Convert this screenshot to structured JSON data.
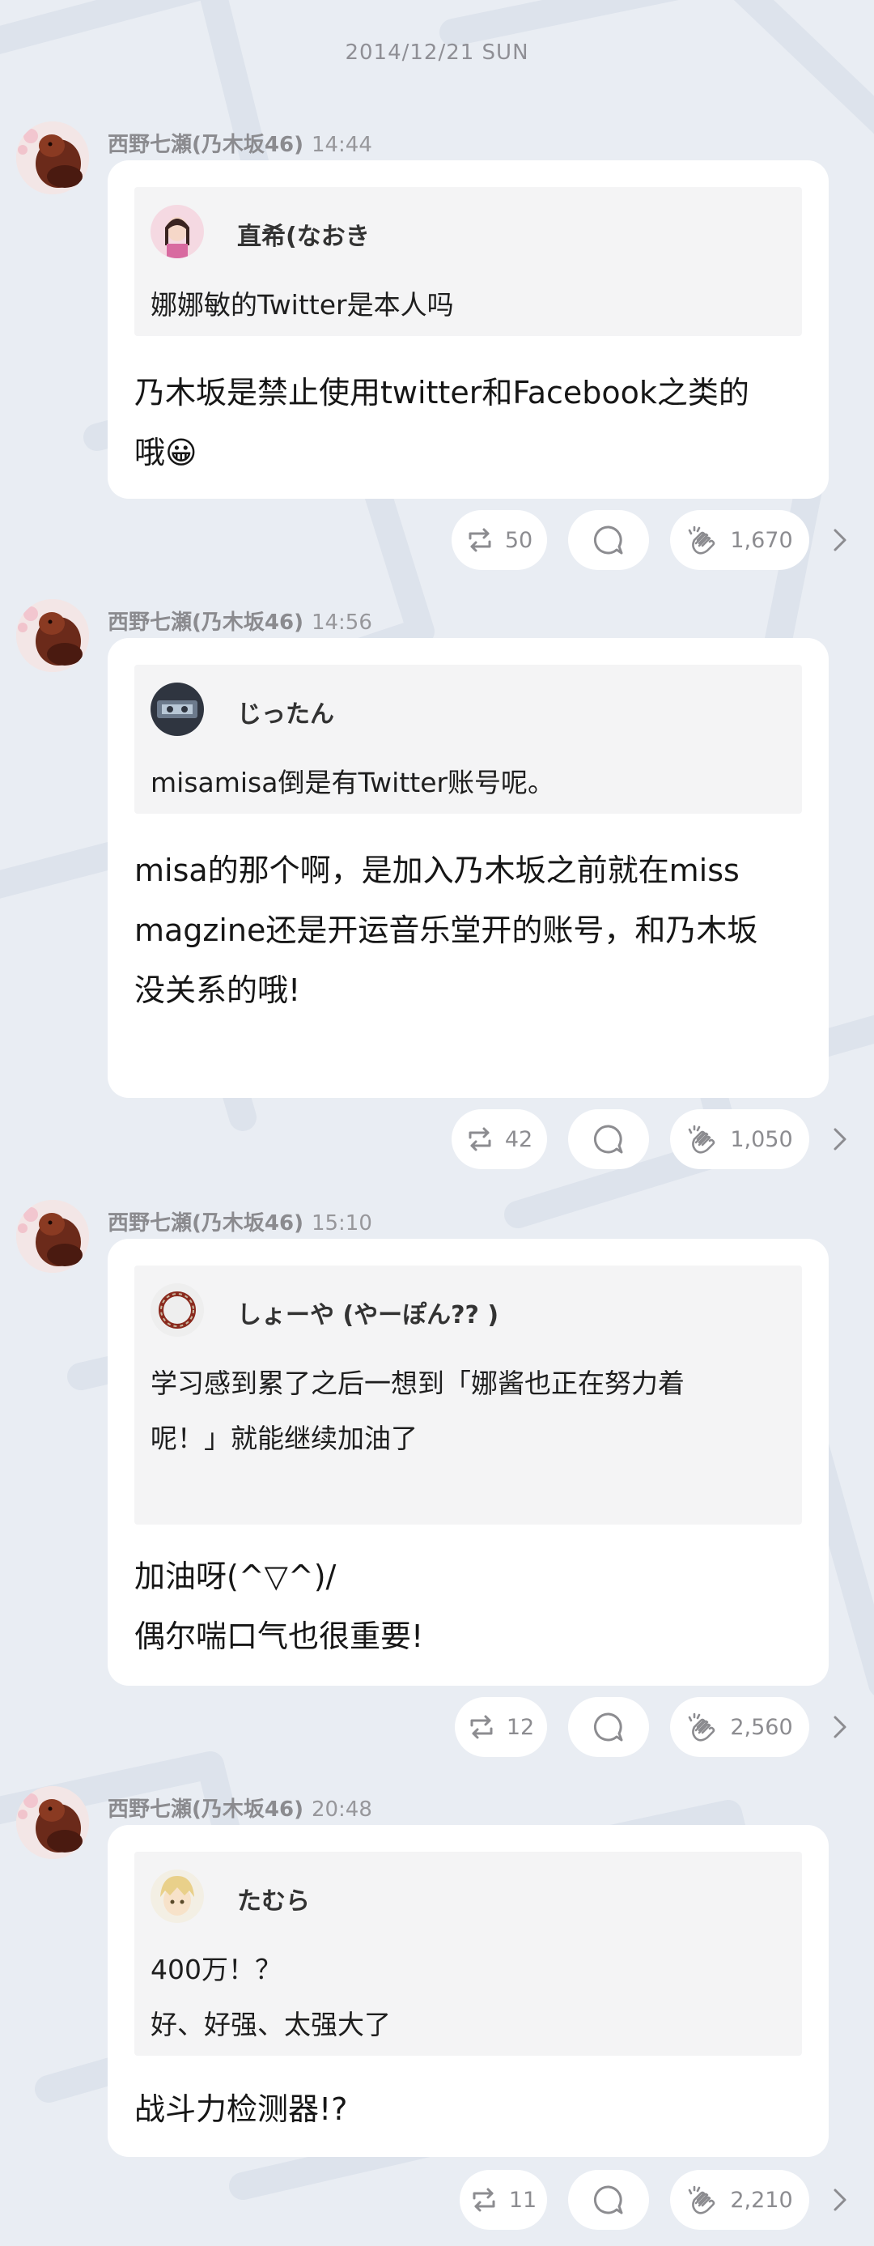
{
  "date_header": "2014/12/21 SUN",
  "messages": [
    {
      "author": "西野七瀬(乃木坂46)",
      "time": "14:44",
      "quote_name": "直希(なおき",
      "quote_text": "娜娜敏的Twitter是本人吗",
      "reply_text": "乃木坂是禁止使用twitter和Facebook之类的\n哦😀",
      "retweets": "50",
      "claps": "1,670"
    },
    {
      "author": "西野七瀬(乃木坂46)",
      "time": "14:56",
      "quote_name": "じったん",
      "quote_text": "misamisa倒是有Twitter账号呢。",
      "reply_text": "misa的那个啊，是加入乃木坂之前就在miss\nmagzine还是开运音乐堂开的账号，和乃木坂\n没关系的哦!",
      "retweets": "42",
      "claps": "1,050"
    },
    {
      "author": "西野七瀬(乃木坂46)",
      "time": "15:10",
      "quote_name": "しょーや (やーぽん?? )",
      "quote_text": "学习感到累了之后一想到「娜酱也正在努力着\n呢！」就能继续加油了",
      "reply_text": "加油呀(^▽^)/\n偶尔喘口气也很重要!",
      "retweets": "12",
      "claps": "2,560"
    },
    {
      "author": "西野七瀬(乃木坂46)",
      "time": "20:48",
      "quote_name": "たむら",
      "quote_text": "400万！？\n好、好强、太强大了",
      "reply_text": "战斗力检测器!?",
      "retweets": "11",
      "claps": "2,210"
    }
  ],
  "icons": {
    "retweet": "retweet-icon",
    "comment": "comment-icon",
    "clap": "clap-icon",
    "chevron": "chevron-right-icon"
  },
  "colors": {
    "background": "#e9edf3",
    "bubble": "#ffffff",
    "quote_background": "#f4f4f5",
    "meta_text": "#8b8b8f"
  }
}
